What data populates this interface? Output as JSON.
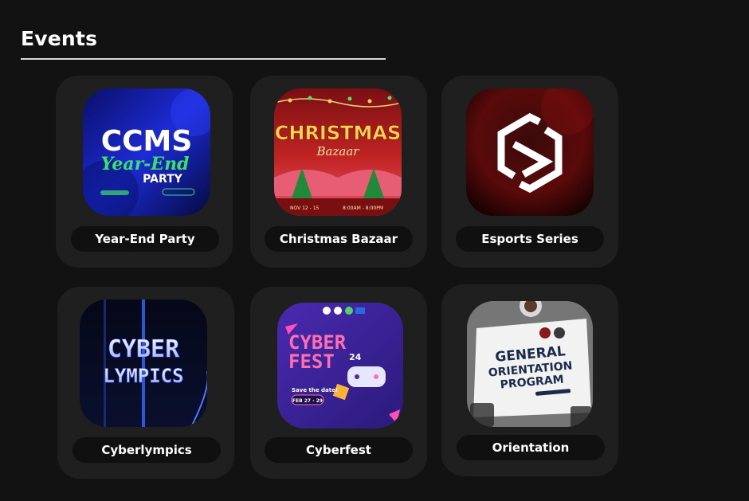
{
  "page": {
    "title": "Events"
  },
  "events": [
    {
      "label": "Year-End Party",
      "poster_text": [
        "CCMS",
        "Year-End",
        "PARTY"
      ],
      "accent": "#1d2bd4"
    },
    {
      "label": "Christmas Bazaar",
      "poster_text": [
        "CHRISTMAS",
        "Bazaar",
        "NOV 12 - 15",
        "8:00AM - 8:00PM"
      ],
      "accent": "#b3201f"
    },
    {
      "label": "Esports Series",
      "poster_text": [],
      "accent": "#5a0a0a"
    },
    {
      "label": "Cyberlympics",
      "poster_text": [
        "CYBER",
        "LYMPICS"
      ],
      "accent": "#1a2a6a"
    },
    {
      "label": "Cyberfest",
      "poster_text": [
        "CYBER",
        "FEST",
        "24",
        "Save the date!",
        "FEB 27 - 29"
      ],
      "accent": "#3a2a9a"
    },
    {
      "label": "Orientation",
      "poster_text": [
        "GENERAL",
        "ORIENTATION",
        "PROGRAM"
      ],
      "accent": "#7a7a7a"
    }
  ]
}
